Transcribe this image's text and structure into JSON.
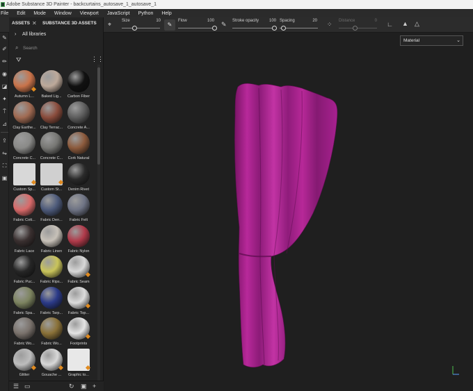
{
  "window": {
    "title": "Adobe Substance 3D Painter - backcurtains_autosave_1_autosave_1"
  },
  "menu": [
    "File",
    "Edit",
    "Mode",
    "Window",
    "Viewport",
    "JavaScript",
    "Python",
    "Help"
  ],
  "toolbar": {
    "size_label": "Size",
    "size_value": "10",
    "flow_label": "Flow",
    "flow_value": "100",
    "stroke_opacity_label": "Stroke opacity",
    "stroke_opacity_value": "100",
    "spacing_label": "Spacing",
    "spacing_value": "20",
    "distance_label": "Distance",
    "distance_value": "0",
    "size_level": 0.1,
    "flow_level": 1.0,
    "stroke_opacity_level": 1.0,
    "spacing_level": 0.2,
    "distance_level": 0.0
  },
  "assets": {
    "tab_assets": "ASSETS",
    "tab_close": "✕",
    "tab_substance": "SUBSTANCE 3D ASSETS",
    "libraries_label": "All libraries",
    "libraries_chevron": "›",
    "search_placeholder": "Search",
    "items": [
      {
        "name": "Autumn L...",
        "color": "#c9734a",
        "badge": true
      },
      {
        "name": "Baked Lig...",
        "color": "#bda99a",
        "badge": false
      },
      {
        "name": "Carbon Fiber",
        "color": "#111111",
        "badge": false
      },
      {
        "name": "Clay Earthe...",
        "color": "#a06a52",
        "badge": false
      },
      {
        "name": "Clay Terrac...",
        "color": "#8a4c3c",
        "badge": false
      },
      {
        "name": "Concrete A...",
        "color": "#5e5e5e",
        "badge": false
      },
      {
        "name": "Concrete C...",
        "color": "#8a8a88",
        "badge": false
      },
      {
        "name": "Concrete C...",
        "color": "#777774",
        "badge": false
      },
      {
        "name": "Cork Natural",
        "color": "#8c5a3c",
        "badge": false
      },
      {
        "name": "Custom Sp...",
        "color": "#d8d8d8",
        "badge": true,
        "flat": true
      },
      {
        "name": "Custom St...",
        "color": "#d0d0d0",
        "badge": true,
        "flat": true
      },
      {
        "name": "Denim Rivet",
        "color": "#2a2a2a",
        "badge": false
      },
      {
        "name": "Fabric Cott...",
        "color": "#d96a6a",
        "badge": false
      },
      {
        "name": "Fabric Den...",
        "color": "#4d5a7a",
        "badge": false
      },
      {
        "name": "Fabric Felt",
        "color": "#6e7384",
        "badge": false
      },
      {
        "name": "Fabric Lace",
        "color": "#3a3030",
        "badge": false
      },
      {
        "name": "Fabric Linen",
        "color": "#c7c1b8",
        "badge": false
      },
      {
        "name": "Fabric Nylon",
        "color": "#b03a4a",
        "badge": false
      },
      {
        "name": "Fabric Puc...",
        "color": "#262626",
        "badge": false
      },
      {
        "name": "Fabric Rips...",
        "color": "#c9c45a",
        "badge": false
      },
      {
        "name": "Fabric Seam",
        "color": "#d8d8d8",
        "badge": true
      },
      {
        "name": "Fabric Spa...",
        "color": "#7d8460",
        "badge": false
      },
      {
        "name": "Fabric Tarp...",
        "color": "#2b3a88",
        "badge": false
      },
      {
        "name": "Fabric Top...",
        "color": "#dcdcdc",
        "badge": true
      },
      {
        "name": "Fabric Wo...",
        "color": "#7a726c",
        "badge": false
      },
      {
        "name": "Fabric Wo...",
        "color": "#8a7138",
        "badge": false
      },
      {
        "name": "Footprints",
        "color": "#e4e4e4",
        "badge": true
      },
      {
        "name": "Glitter",
        "color": "#bdbdbd",
        "badge": true
      },
      {
        "name": "Gouache ...",
        "color": "#d8d8d8",
        "badge": true
      },
      {
        "name": "Graphic to...",
        "color": "#e8e8e8",
        "badge": true,
        "flat": true
      }
    ]
  },
  "viewport": {
    "material_select": "Material",
    "curtain_color": "#b0238f"
  },
  "icons": {
    "filter": "⛛",
    "grid": "⋮⋮"
  }
}
